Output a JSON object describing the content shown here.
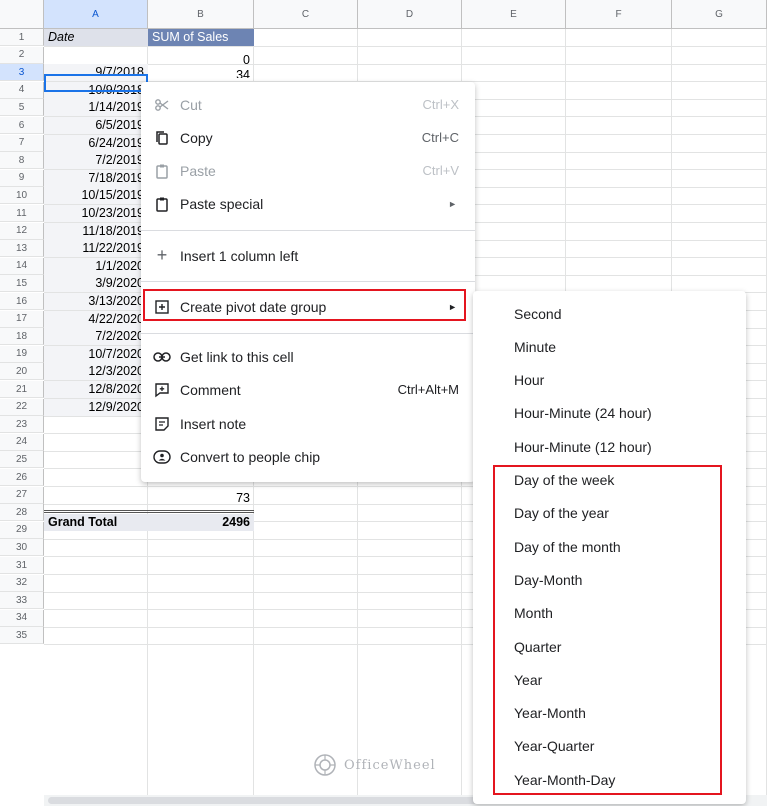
{
  "sheet": {
    "columns": [
      "A",
      "B",
      "C",
      "D",
      "E",
      "F",
      "G"
    ],
    "rows": [
      "1",
      "2",
      "3",
      "4",
      "5",
      "6",
      "7",
      "8",
      "9",
      "10",
      "11",
      "12",
      "13",
      "14",
      "15",
      "16",
      "17",
      "18",
      "19",
      "20",
      "21",
      "22",
      "23",
      "24",
      "25",
      "26",
      "27",
      "28",
      "29",
      "30",
      "31",
      "32",
      "33",
      "34",
      "35"
    ],
    "header": {
      "date": "Date",
      "sales": "SUM of Sales"
    },
    "row2_value": "0",
    "row3_value_partial": "34",
    "dates": [
      "9/7/2018",
      "10/9/2018",
      "1/14/2019",
      "6/5/2019",
      "6/24/2019",
      "7/2/2019",
      "7/18/2019",
      "10/15/2019",
      "10/23/2019",
      "11/18/2019",
      "11/22/2019",
      "1/1/2020",
      "3/9/2020",
      "3/13/2020",
      "4/22/2020",
      "7/2/2020",
      "10/7/2020",
      "12/3/2020",
      "12/8/2020",
      "12/9/2020"
    ],
    "row22_value": "73",
    "grand_total": {
      "label": "Grand Total",
      "value": "2496"
    }
  },
  "context_menu": {
    "cut": {
      "label": "Cut",
      "shortcut": "Ctrl+X"
    },
    "copy": {
      "label": "Copy",
      "shortcut": "Ctrl+C"
    },
    "paste": {
      "label": "Paste",
      "shortcut": "Ctrl+V"
    },
    "paste_special": {
      "label": "Paste special"
    },
    "insert_column": {
      "label": "Insert 1 column left"
    },
    "pivot_group": {
      "label": "Create pivot date group"
    },
    "get_link": {
      "label": "Get link to this cell"
    },
    "comment": {
      "label": "Comment",
      "shortcut": "Ctrl+Alt+M"
    },
    "insert_note": {
      "label": "Insert note"
    },
    "people_chip": {
      "label": "Convert to people chip"
    }
  },
  "submenu": [
    "Second",
    "Minute",
    "Hour",
    "Hour-Minute (24 hour)",
    "Hour-Minute (12 hour)",
    "Day of the week",
    "Day of the year",
    "Day of the month",
    "Day-Month",
    "Month",
    "Quarter",
    "Year",
    "Year-Month",
    "Year-Quarter",
    "Year-Month-Day"
  ],
  "watermark": "OfficeWheel",
  "colors": {
    "highlight": "#e4151f",
    "header_blue": "#6d84b3",
    "selection": "#1a73e8"
  }
}
